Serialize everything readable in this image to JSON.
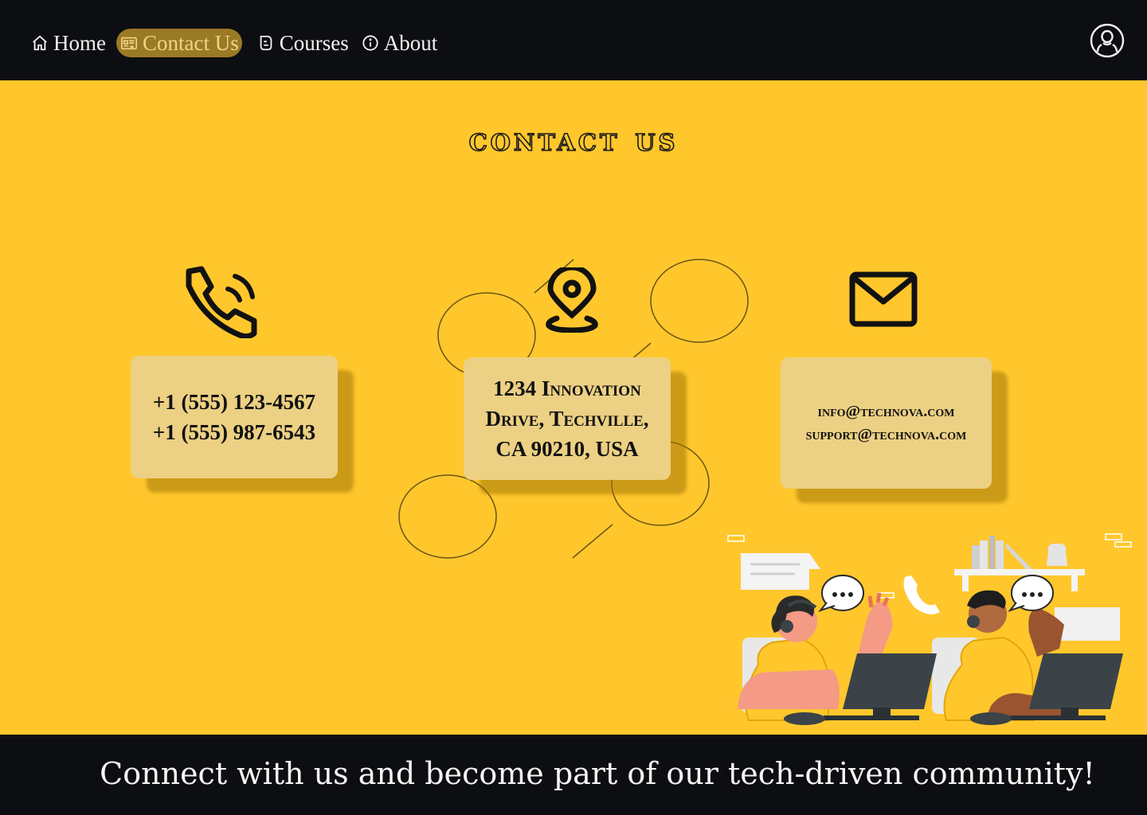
{
  "nav": {
    "items": [
      {
        "label": "Home",
        "icon": "home-icon",
        "active": false
      },
      {
        "label": "Contact Us",
        "icon": "contact-card-icon",
        "active": true
      },
      {
        "label": "Courses",
        "icon": "courses-icon",
        "active": false
      },
      {
        "label": "About",
        "icon": "info-icon",
        "active": false
      }
    ],
    "user_icon": "user-icon"
  },
  "page": {
    "title": "Contact Us"
  },
  "contact": {
    "phone": {
      "icon": "phone-icon",
      "lines": [
        "+1 (555) 123-4567",
        "+1 (555) 987-6543"
      ]
    },
    "address": {
      "icon": "location-icon",
      "lines": [
        "1234 Innovation",
        "Drive, Techville,",
        "CA 90210, USA"
      ]
    },
    "email": {
      "icon": "mail-icon",
      "lines": [
        "info@technova.com",
        "support@technova.com"
      ]
    }
  },
  "footer": {
    "text": "Connect with us and become part of our tech-driven community!"
  },
  "colors": {
    "background": "#ffc72c",
    "navbar": "#0d0e11",
    "card": "#ecd083",
    "active_tab": "#9a7a25"
  }
}
